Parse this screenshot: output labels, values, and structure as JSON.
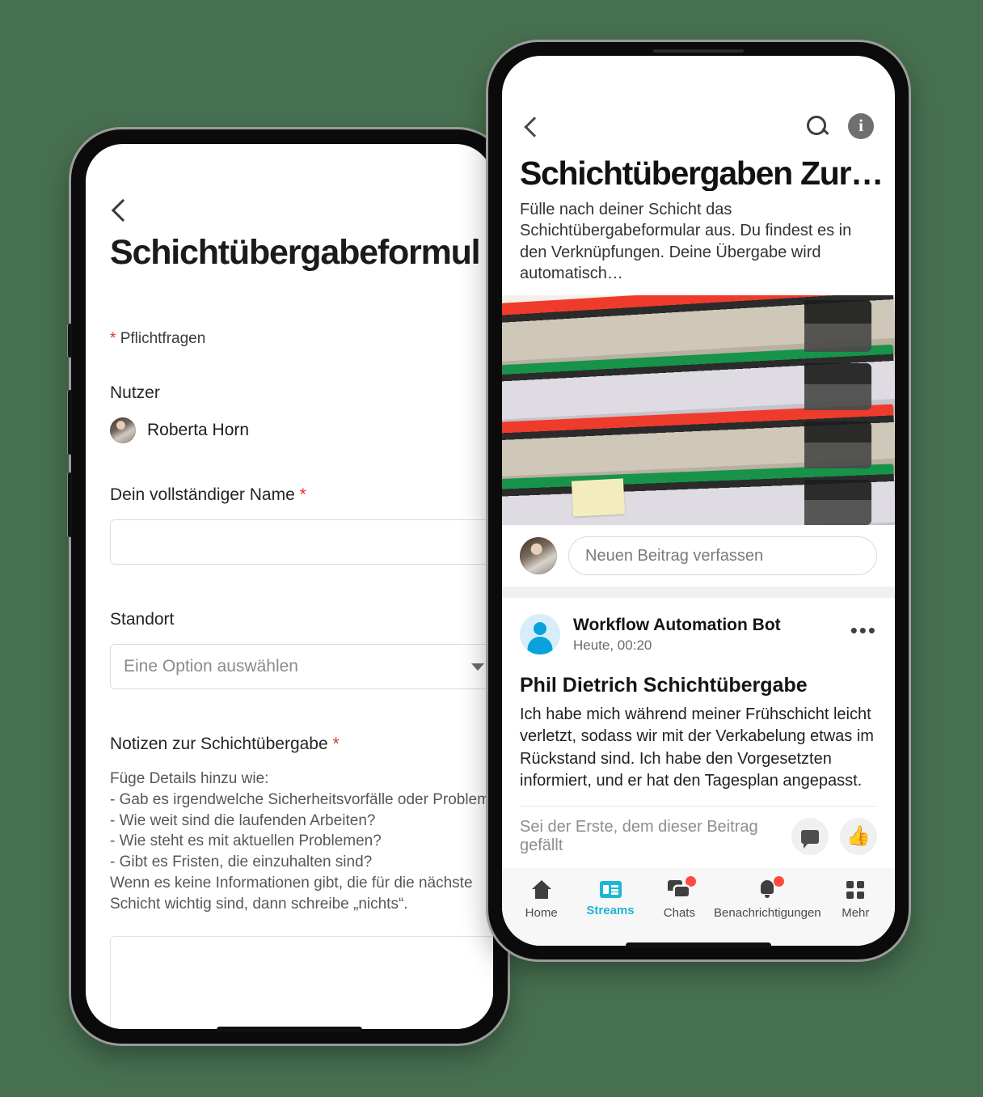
{
  "theme": {
    "background": "#477050",
    "accent": "#1fb6d6",
    "required_asterisk": "#e2332a",
    "badge": "#ff4b40"
  },
  "left_phone": {
    "back_icon": "chevron-left-icon",
    "title": "Schichtübergabeformul",
    "required_note": "Pflichtfragen",
    "asterisk": "*",
    "user_field": {
      "label": "Nutzer",
      "value": "Roberta Horn"
    },
    "name_field": {
      "label": "Dein vollständiger Name",
      "required_mark": "*",
      "value": ""
    },
    "location_field": {
      "label": "Standort",
      "placeholder": "Eine Option auswählen",
      "caret_icon": "chevron-down-icon"
    },
    "notes_field": {
      "label": "Notizen zur Schichtübergabe",
      "required_mark": "*",
      "help": "Füge Details hinzu wie:\n- Gab es irgendwelche Sicherheitsvorfälle oder Probleme?\n- Wie weit sind die laufenden Arbeiten?\n- Wie steht es mit aktuellen Problemen?\n- Gibt es Fristen, die einzuhalten sind?\nWenn es keine Informationen gibt, die für die nächste\nSchicht wichtig sind, dann schreibe „nichts“.",
      "value": ""
    }
  },
  "right_phone": {
    "topbar": {
      "back_icon": "chevron-left-icon",
      "search_icon": "search-icon",
      "info_icon": "info-icon",
      "info_glyph": "i"
    },
    "stream": {
      "title": "Schichtübergaben Zur…",
      "description": "Fülle nach deiner Schicht das Schichtübergabeformular aus. Du findest es in den Verknüpfungen. Deine Übergabe wird automatisch…",
      "hero_image": "stack-of-ring-binders-photo"
    },
    "composer": {
      "avatar": "user-avatar",
      "placeholder": "Neuen Beitrag verfassen"
    },
    "post": {
      "avatar_icon": "bot-avatar-icon",
      "author": "Workflow Automation Bot",
      "timestamp": "Heute, 00:20",
      "more_icon": "more-options-icon",
      "title": "Phil Dietrich Schichtübergabe",
      "body": "Ich habe mich während meiner Frühschicht leicht verletzt, sodass wir mit der Verkabelung etwas im Rückstand sind. Ich habe den Vorgesetzten informiert, und er hat den Tagesplan angepasst.",
      "like_prompt": "Sei der Erste, dem dieser Beitrag gefällt",
      "comment_icon": "comment-icon",
      "like_icon": "thumbs-up-icon"
    },
    "tabbar": [
      {
        "label": "Home",
        "icon": "home-icon",
        "active": false,
        "badge": false
      },
      {
        "label": "Streams",
        "icon": "streams-icon",
        "active": true,
        "badge": false
      },
      {
        "label": "Chats",
        "icon": "chats-icon",
        "active": false,
        "badge": true
      },
      {
        "label": "Benachrichtigungen",
        "icon": "bell-icon",
        "active": false,
        "badge": true
      },
      {
        "label": "Mehr",
        "icon": "grid-icon",
        "active": false,
        "badge": false
      }
    ]
  }
}
